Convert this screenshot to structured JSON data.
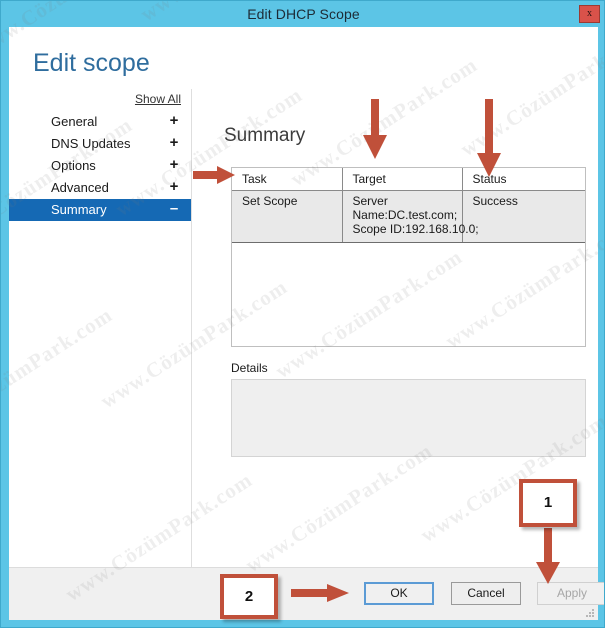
{
  "window": {
    "title": "Edit DHCP Scope",
    "close_label": "x"
  },
  "page": {
    "heading": "Edit scope"
  },
  "nav": {
    "show_all": "Show All",
    "items": [
      {
        "label": "General",
        "toggle": "+",
        "selected": false
      },
      {
        "label": "DNS Updates",
        "toggle": "+",
        "selected": false
      },
      {
        "label": "Options",
        "toggle": "+",
        "selected": false
      },
      {
        "label": "Advanced",
        "toggle": "+",
        "selected": false
      },
      {
        "label": "Summary",
        "toggle": "–",
        "selected": true
      }
    ]
  },
  "content": {
    "heading": "Summary",
    "table": {
      "columns": [
        "Task",
        "Target",
        "Status"
      ],
      "rows": [
        {
          "task": "Set Scope",
          "target_lines": [
            "Server",
            "Name:DC.test.com;",
            "Scope ID:192.168.10.0;"
          ],
          "status": "Success"
        }
      ]
    },
    "details": {
      "label": "Details",
      "value": ""
    }
  },
  "footer": {
    "ok_label": "OK",
    "cancel_label": "Cancel",
    "apply_label": "Apply"
  },
  "annotations": {
    "callouts": [
      {
        "id": "1",
        "label": "1"
      },
      {
        "id": "2",
        "label": "2"
      }
    ],
    "arrow_color": "#c0503a"
  },
  "watermark": {
    "text": "www.CözümPark.com"
  },
  "colors": {
    "titlebar": "#5cc5e6",
    "accent_heading": "#2f6d9e",
    "nav_selected": "#1569b4",
    "close_button": "#d9524a",
    "annotation": "#c0503a"
  }
}
